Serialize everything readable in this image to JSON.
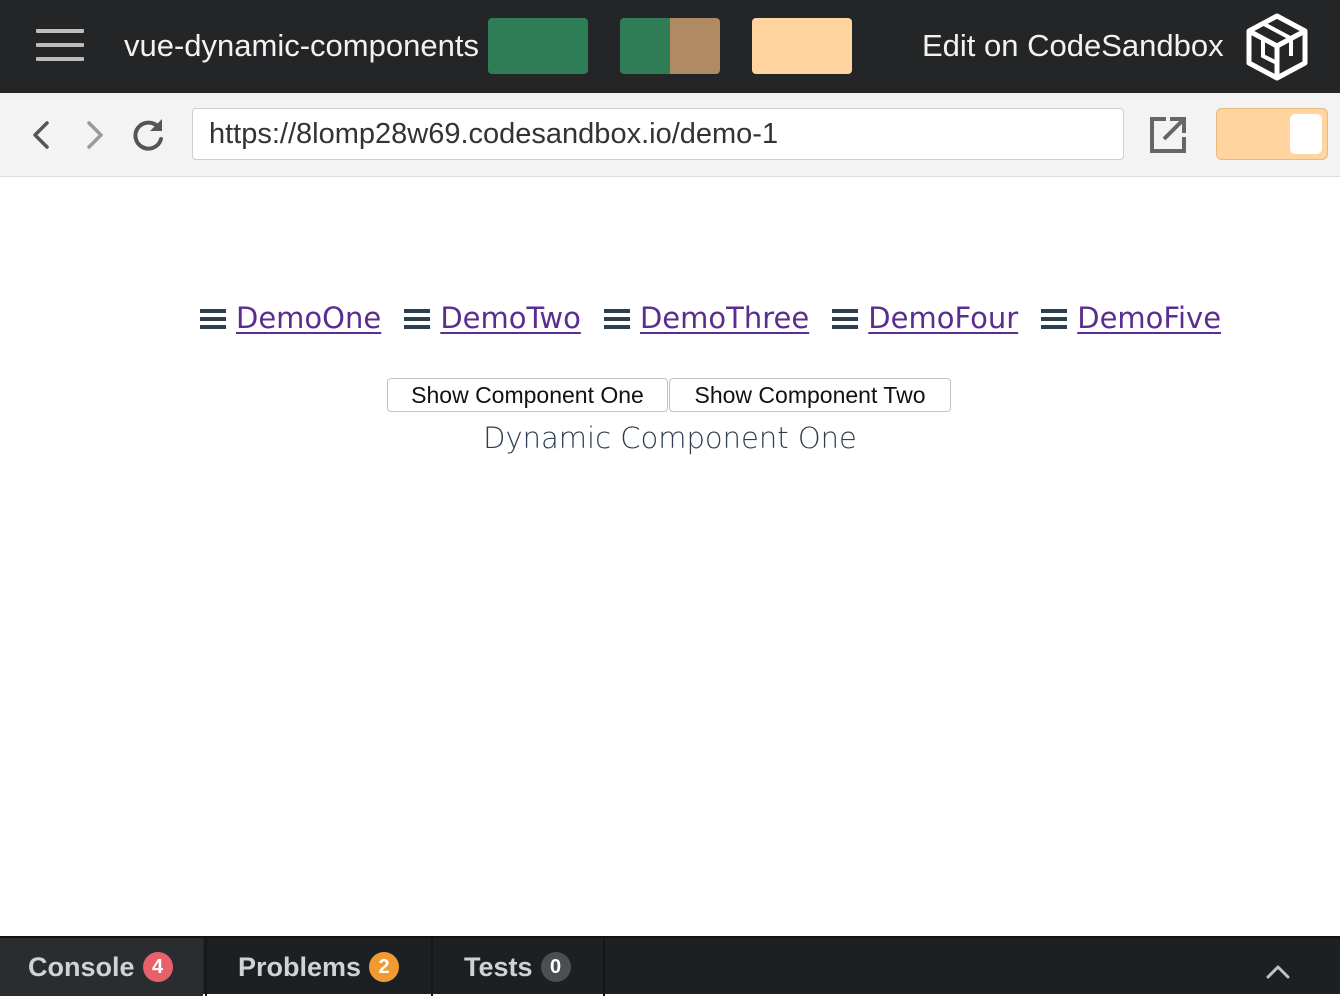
{
  "header": {
    "sandbox_name": "vue-dynamic-components",
    "edit_label": "Edit on CodeSandbox",
    "swatches": [
      {
        "colors": [
          "#2e7d57"
        ]
      },
      {
        "colors": [
          "#2e7d57",
          "#b08a63"
        ]
      },
      {
        "colors": [
          "#ffd49e"
        ]
      }
    ]
  },
  "navigation": {
    "url": "https://8lomp28w69.codesandbox.io/demo-1",
    "toggle_color": "#ffd49e"
  },
  "preview": {
    "nav_links": [
      "DemoOne",
      "DemoTwo",
      "DemoThree",
      "DemoFour",
      "DemoFive"
    ],
    "buttons": {
      "one": "Show Component One",
      "two": "Show Component Two"
    },
    "dynamic_text": "Dynamic Component One"
  },
  "devtools": {
    "tabs": [
      {
        "label": "Console",
        "count": "4",
        "color": "#e8606a"
      },
      {
        "label": "Problems",
        "count": "2",
        "color": "#f09a32"
      },
      {
        "label": "Tests",
        "count": "0",
        "color": "#4a4f54"
      }
    ]
  },
  "colors": {
    "header_bg": "#242526",
    "link": "#5c2d91",
    "text": "#2c3e50"
  }
}
